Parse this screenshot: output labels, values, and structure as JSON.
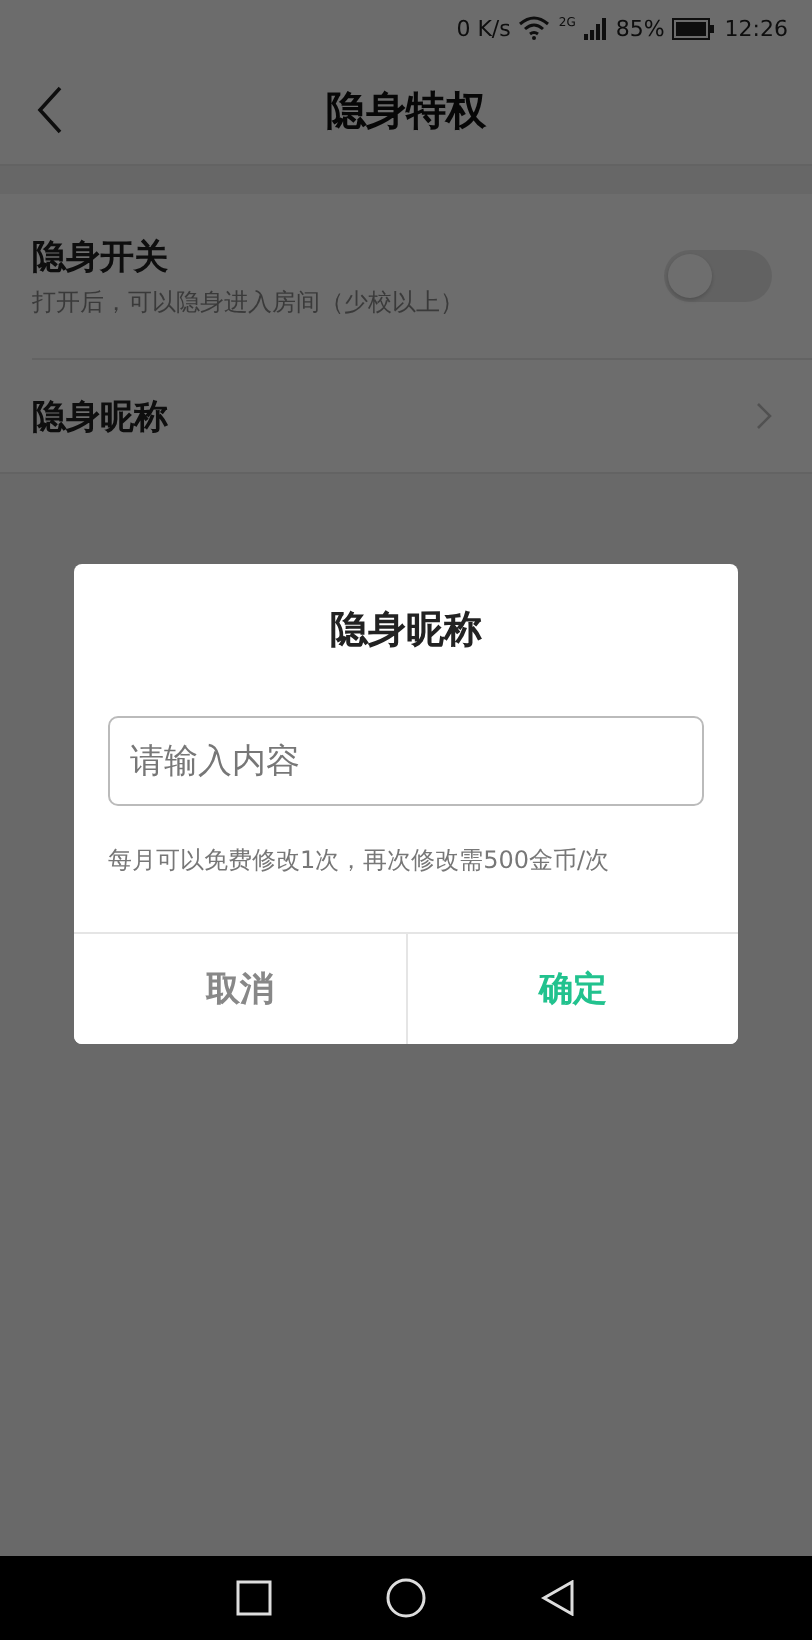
{
  "status_bar": {
    "speed": "0 K/s",
    "network": "2G",
    "battery": "85%",
    "time": "12:26"
  },
  "header": {
    "title": "隐身特权"
  },
  "settings": [
    {
      "kind": "toggle",
      "label": "隐身开关",
      "description": "打开后，可以隐身进入房间（少校以上）",
      "on": false
    },
    {
      "kind": "link",
      "label": "隐身昵称"
    }
  ],
  "dialog": {
    "title": "隐身昵称",
    "input": {
      "placeholder": "请输入内容"
    },
    "hint": "每月可以免费修改1次，再次修改需500金币/次",
    "buttons": [
      {
        "label": "取消",
        "primary": false
      },
      {
        "label": "确定",
        "primary": true
      }
    ]
  }
}
